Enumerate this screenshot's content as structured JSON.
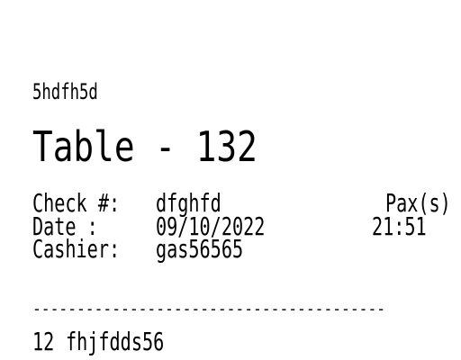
{
  "receipt": {
    "header_code": "5hdfh5d",
    "table_title": "Table - 132",
    "check_label": "Check #:",
    "check_value": "dfghfd",
    "pax_label": "Pax(s)",
    "date_label": "Date    :",
    "date_value": "09/10/2022",
    "time_value": "21:51",
    "cashier_label": "Cashier:",
    "cashier_value": "gas56565",
    "separator": "----------------------------------------",
    "item_quantity": "12",
    "item_name": "fhjfdds56"
  },
  "colors": {
    "background": "#ffffff",
    "text": "#000000"
  }
}
